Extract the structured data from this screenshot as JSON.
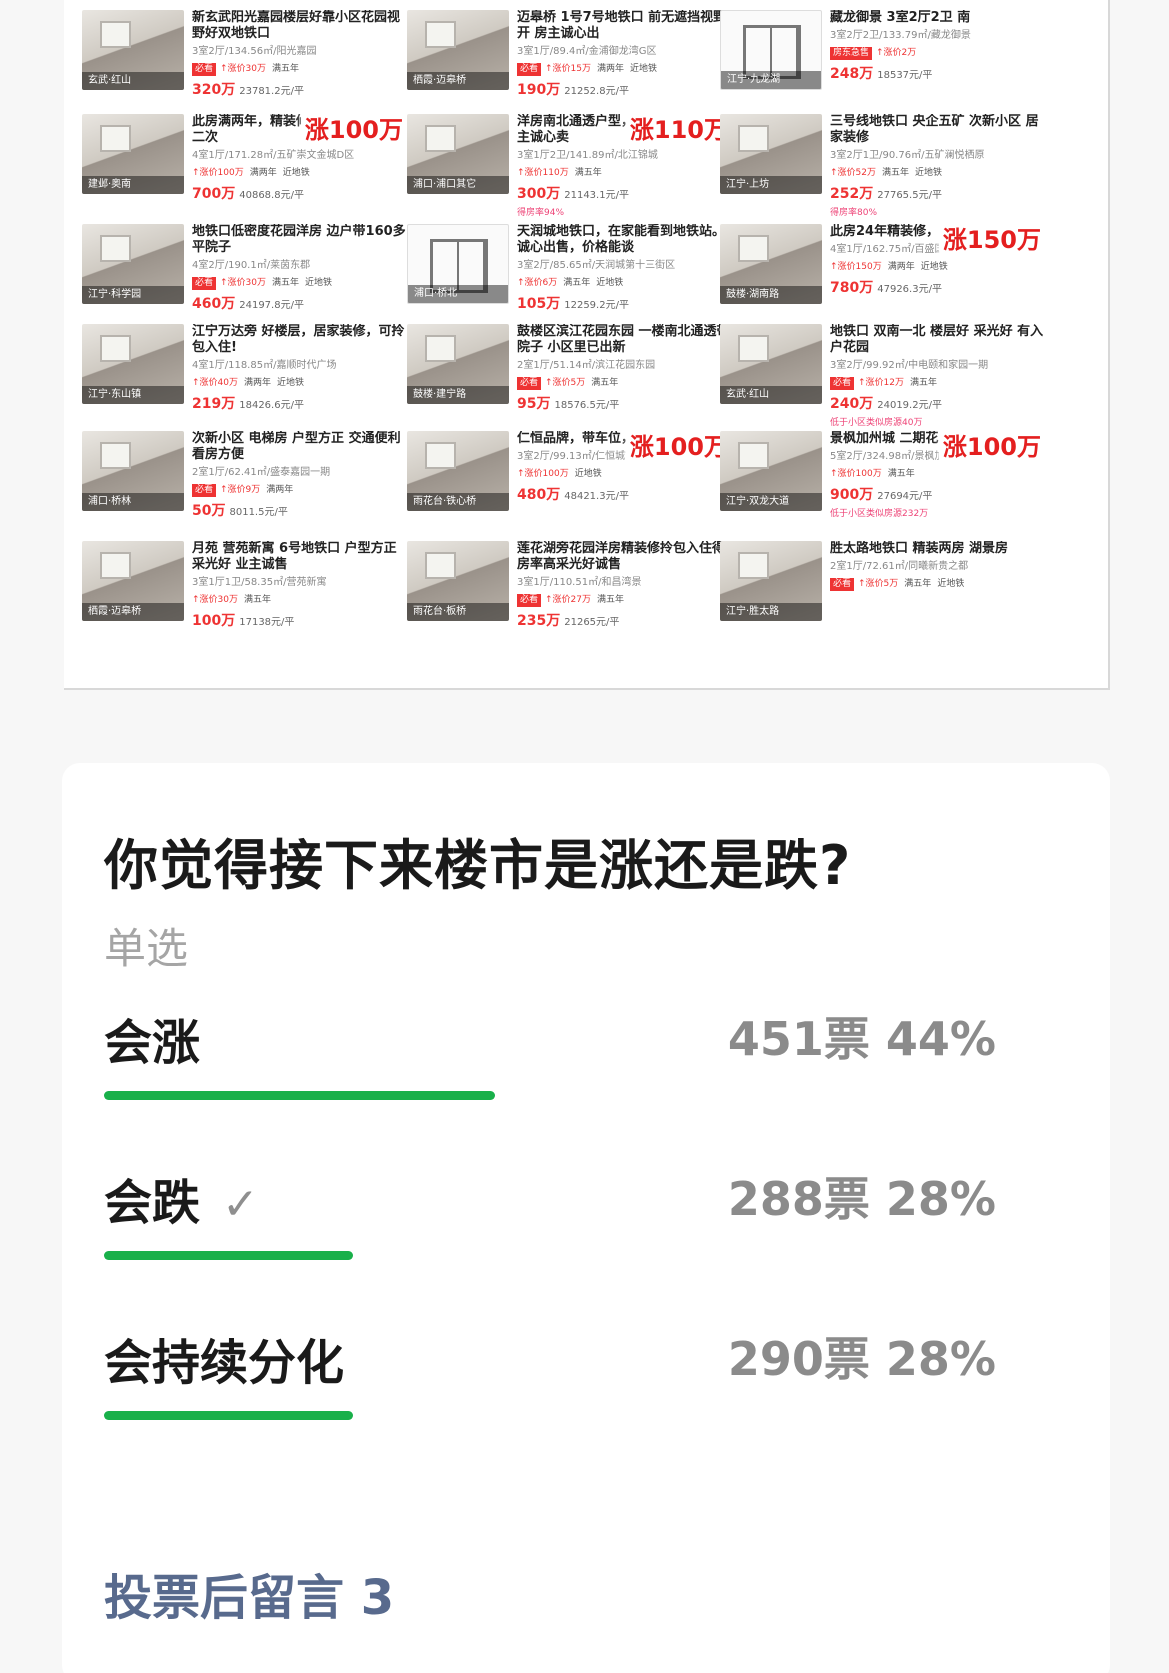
{
  "listings": [
    [
      {
        "title": "新玄武阳光嘉园楼层好靠小区花园视野好双地铁口",
        "meta": "3室2厅/134.56㎡/阳光嘉园",
        "tags": [
          "必看",
          "涨价30万",
          "满五年"
        ],
        "price": "320万",
        "unit": "23781.2元/平",
        "loc": "玄武·红山",
        "badge": "",
        "sub": ""
      },
      {
        "title": "此房满两年，精装修，正，采光好，二次",
        "meta": "4室1厅/171.28㎡/五矿崇文金城D区",
        "tags": [
          "涨价100万",
          "满两年",
          "近地铁"
        ],
        "price": "700万",
        "unit": "40868.8元/平",
        "loc": "建邺·奥南",
        "badge": "涨100万",
        "sub": ""
      },
      {
        "title": "地铁口低密度花园洋房 边户带160多平院子",
        "meta": "4室2厅/190.1㎡/莱茵东郡",
        "tags": [
          "必看",
          "涨价30万",
          "满五年",
          "近地铁"
        ],
        "price": "460万",
        "unit": "24197.8元/平",
        "loc": "江宁·科学园",
        "badge": "",
        "sub": ""
      },
      {
        "title": "江宁万达旁 好楼层，居家装修，可拎包入住!",
        "meta": "4室1厅/118.85㎡/嘉顺时代广场",
        "tags": [
          "涨价40万",
          "满两年",
          "近地铁"
        ],
        "price": "219万",
        "unit": "18426.6元/平",
        "loc": "江宁·东山镇",
        "badge": "",
        "sub": ""
      },
      {
        "title": "次新小区 电梯房 户型方正 交通便利 看房方便",
        "meta": "2室1厅/62.41㎡/盛泰嘉园一期",
        "tags": [
          "必看",
          "涨价9万",
          "满两年"
        ],
        "price": "50万",
        "unit": "8011.5元/平",
        "loc": "浦口·桥林",
        "badge": "",
        "sub": ""
      },
      {
        "title": "月苑 营苑新寓 6号地铁口 户型方正 采光好 业主诚售",
        "meta": "3室1厅1卫/58.35㎡/营苑新寓",
        "tags": [
          "涨价30万",
          "满五年"
        ],
        "price": "100万",
        "unit": "17138元/平",
        "loc": "栖霞·迈皋桥",
        "badge": "",
        "sub": ""
      }
    ],
    [
      {
        "title": "迈皋桥 1号7号地铁口 前无遮挡视野开 房主诚心出",
        "meta": "3室1厅/89.4㎡/金浦御龙湾G区",
        "tags": [
          "必看",
          "涨价15万",
          "满两年",
          "近地铁"
        ],
        "price": "190万",
        "unit": "21252.8元/平",
        "loc": "栖霞·迈皋桥",
        "badge": "",
        "sub": ""
      },
      {
        "title": "洋房南北通透户型，价格可以谈，业主诚心卖",
        "meta": "3室1厅2卫/141.89㎡/北江锦城",
        "tags": [
          "涨价110万",
          "满五年"
        ],
        "price": "300万",
        "unit": "21143.1元/平",
        "loc": "浦口·浦口其它",
        "badge": "涨110万",
        "sub": "得房率94%"
      },
      {
        "title": "天润城地铁口，在家能看到地铁站。诚心出售，价格能谈",
        "meta": "3室2厅/85.65㎡/天润城第十三街区",
        "tags": [
          "涨价6万",
          "满五年",
          "近地铁"
        ],
        "price": "105万",
        "unit": "12259.2元/平",
        "loc": "浦口·桥北",
        "badge": "",
        "sub": ""
      },
      {
        "title": "鼓楼区滨江花园东园 一楼南北通透带院子 小区里已出新",
        "meta": "2室1厅/51.14㎡/滨江花园东园",
        "tags": [
          "必看",
          "涨价5万",
          "满五年"
        ],
        "price": "95万",
        "unit": "18576.5元/平",
        "loc": "鼓楼·建宁路",
        "badge": "",
        "sub": ""
      },
      {
        "title": "仁恒品牌，带车位，中高楼层",
        "meta": "3室2厅/99.13㎡/仁恒城市星光",
        "tags": [
          "涨价100万",
          "近地铁"
        ],
        "price": "480万",
        "unit": "48421.3元/平",
        "loc": "雨花台·铁心桥",
        "badge": "涨100万",
        "sub": ""
      },
      {
        "title": "莲花湖旁花园洋房精装修拎包入住得房率高采光好诚售",
        "meta": "3室1厅/110.51㎡/和昌湾景",
        "tags": [
          "必看",
          "涨价27万",
          "满五年"
        ],
        "price": "235万",
        "unit": "21265元/平",
        "loc": "雨花台·板桥",
        "badge": "",
        "sub": ""
      }
    ],
    [
      {
        "title": "藏龙御景 3室2厅2卫 南",
        "meta": "3室2厅2卫/133.79㎡/藏龙御景",
        "tags": [
          "房东急售",
          "涨价2万"
        ],
        "price": "248万",
        "unit": "18537元/平",
        "loc": "江宁·九龙湖",
        "badge": "",
        "sub": ""
      },
      {
        "title": "三号线地铁口 央企五矿 次新小区 居家装修",
        "meta": "3室2厅1卫/90.76㎡/五矿澜悦栖原",
        "tags": [
          "涨价52万",
          "满五年",
          "近地铁"
        ],
        "price": "252万",
        "unit": "27765.5元/平",
        "loc": "江宁·上坊",
        "badge": "",
        "sub": "得房率80%"
      },
      {
        "title": "此房24年精装修，偶尔过来住下",
        "meta": "4室1厅/162.75㎡/百盛国际大厦",
        "tags": [
          "涨价150万",
          "满两年",
          "近地铁"
        ],
        "price": "780万",
        "unit": "47926.3元/平",
        "loc": "鼓楼·湖南路",
        "badge": "涨150万",
        "sub": ""
      },
      {
        "title": "地铁口 双南一北 楼层好 采光好 有入户花园",
        "meta": "3室2厅/99.92㎡/中电颐和家园一期",
        "tags": [
          "必看",
          "涨价12万",
          "满五年"
        ],
        "price": "240万",
        "unit": "24019.2元/平",
        "loc": "玄武·红山",
        "badge": "",
        "sub": "低于小区类似房源40万"
      },
      {
        "title": "景枫加州城 二期花园 精装修 拎包",
        "meta": "5室2厅/324.98㎡/景枫加州城",
        "tags": [
          "涨价100万",
          "满五年"
        ],
        "price": "900万",
        "unit": "27694元/平",
        "loc": "江宁·双龙大道",
        "badge": "涨100万",
        "sub": "低于小区类似房源232万"
      },
      {
        "title": "胜太路地铁口 精装两房 湖景房",
        "meta": "2室1厅/72.61㎡/同曦新贵之都",
        "tags": [
          "必看",
          "涨价5万",
          "满五年",
          "近地铁"
        ],
        "price": "",
        "unit": "",
        "loc": "江宁·胜太路",
        "badge": "",
        "sub": ""
      }
    ]
  ],
  "poll": {
    "question": "你觉得接下来楼市是涨还是跌?",
    "mode": "单选",
    "options": [
      {
        "label": "会涨",
        "votes": "451票",
        "pct": "44%",
        "share": 0.44,
        "selected": false
      },
      {
        "label": "会跌",
        "votes": "288票",
        "pct": "28%",
        "share": 0.28,
        "selected": true
      },
      {
        "label": "会持续分化",
        "votes": "290票",
        "pct": "28%",
        "share": 0.28,
        "selected": false
      }
    ],
    "comments": "投票后留言 3",
    "check_icon": "check-icon",
    "accent": "#19b04a"
  }
}
